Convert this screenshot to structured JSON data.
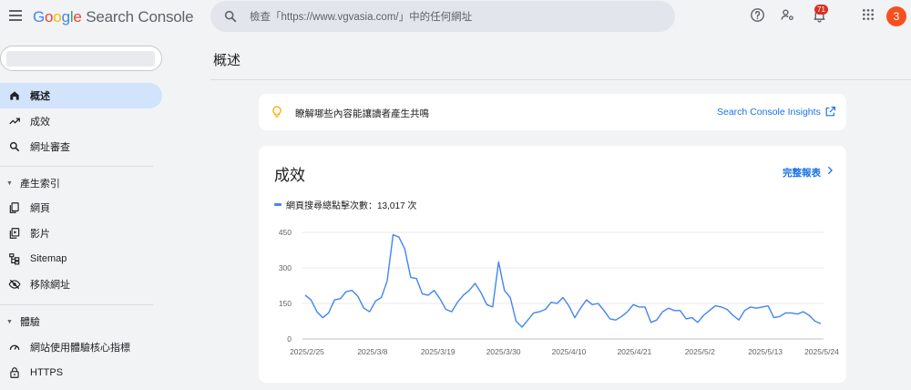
{
  "app": {
    "logo_parts": [
      "G",
      "o",
      "o",
      "g",
      "l",
      "e"
    ],
    "logo_rest": " Search Console"
  },
  "search": {
    "placeholder": "檢查「https://www.vgvasia.com/」中的任何網址"
  },
  "topbar": {
    "notification_count": "71",
    "avatar_letter": "3"
  },
  "sidebar": {
    "items": [
      {
        "label": "概述",
        "icon": "home-icon",
        "active": true
      },
      {
        "label": "成效",
        "icon": "trending-up-icon"
      },
      {
        "label": "網址審查",
        "icon": "search-icon"
      }
    ],
    "sections": [
      {
        "label": "產生索引",
        "items": [
          {
            "label": "網頁",
            "icon": "pages-icon"
          },
          {
            "label": "影片",
            "icon": "video-icon"
          },
          {
            "label": "Sitemap",
            "icon": "sitemap-icon"
          },
          {
            "label": "移除網址",
            "icon": "eye-off-icon"
          }
        ]
      },
      {
        "label": "體驗",
        "items": [
          {
            "label": "網站使用體驗核心指標",
            "icon": "speed-icon"
          },
          {
            "label": "HTTPS",
            "icon": "lock-icon"
          }
        ]
      }
    ]
  },
  "main": {
    "title": "概述",
    "insight": {
      "message": "瞭解哪些內容能讓讀者產生共鳴",
      "link": "Search Console Insights"
    },
    "performance": {
      "title": "成效",
      "full_report": "完整報表",
      "legend": "網頁搜尋總點擊次數：13,017 次"
    }
  },
  "colors": {
    "accent": "#1a73e8",
    "series": "#4285f4",
    "badge": "#d93025",
    "avatar": "#f4511e"
  },
  "chart_data": {
    "type": "line",
    "title": "",
    "xlabel": "",
    "ylabel": "",
    "ylim": [
      0,
      450
    ],
    "yticks": [
      0,
      150,
      300,
      450
    ],
    "xtick_labels": [
      "2025/2/25",
      "2025/3/8",
      "2025/3/19",
      "2025/3/30",
      "2025/4/10",
      "2025/4/21",
      "2025/5/2",
      "2025/5/13",
      "2025/5/24"
    ],
    "grid": true,
    "series": [
      {
        "name": "網頁搜尋總點擊次數",
        "start_date": "2025-02-25",
        "values": [
          185,
          165,
          115,
          90,
          110,
          165,
          170,
          200,
          205,
          180,
          130,
          115,
          160,
          175,
          245,
          440,
          430,
          380,
          260,
          255,
          190,
          185,
          205,
          170,
          125,
          115,
          155,
          185,
          205,
          235,
          195,
          145,
          135,
          325,
          205,
          175,
          75,
          50,
          80,
          110,
          115,
          125,
          155,
          150,
          175,
          140,
          90,
          130,
          165,
          145,
          150,
          120,
          85,
          80,
          95,
          115,
          145,
          135,
          135,
          70,
          80,
          115,
          130,
          120,
          120,
          85,
          90,
          70,
          100,
          120,
          140,
          135,
          125,
          100,
          80,
          120,
          135,
          130,
          135,
          140,
          90,
          95,
          110,
          110,
          105,
          115,
          100,
          75,
          65
        ]
      }
    ]
  }
}
